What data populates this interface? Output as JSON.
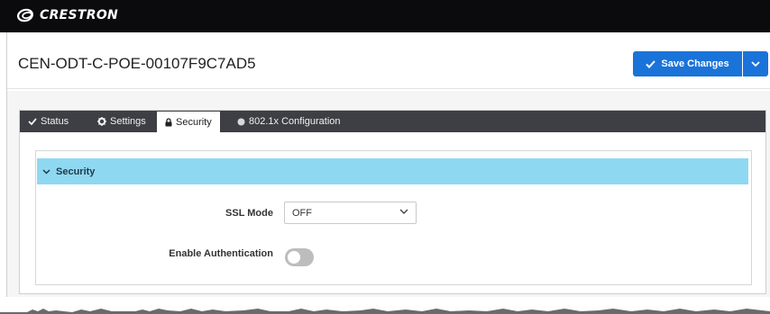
{
  "brand": {
    "name": "CRESTRON",
    "logo_icon": "crestron-swirl-icon"
  },
  "device": {
    "name": "CEN-ODT-C-POE-00107F9C7AD5"
  },
  "toolbar": {
    "save_label": "Save Changes",
    "accent": "#1a73d9"
  },
  "tabs": [
    {
      "label": "Status",
      "icon": "check-icon"
    },
    {
      "label": "Settings",
      "icon": "gear-icon"
    },
    {
      "label": "Security",
      "icon": "lock-icon",
      "active": true
    },
    {
      "label": "802.1x Configuration",
      "icon": "circle-icon"
    }
  ],
  "security": {
    "title": "Security",
    "header_color": "#8fd8f2",
    "ssl_mode": {
      "label": "SSL Mode",
      "value": "OFF"
    },
    "authentication": {
      "label": "Enable Authentication",
      "enabled": false
    }
  }
}
